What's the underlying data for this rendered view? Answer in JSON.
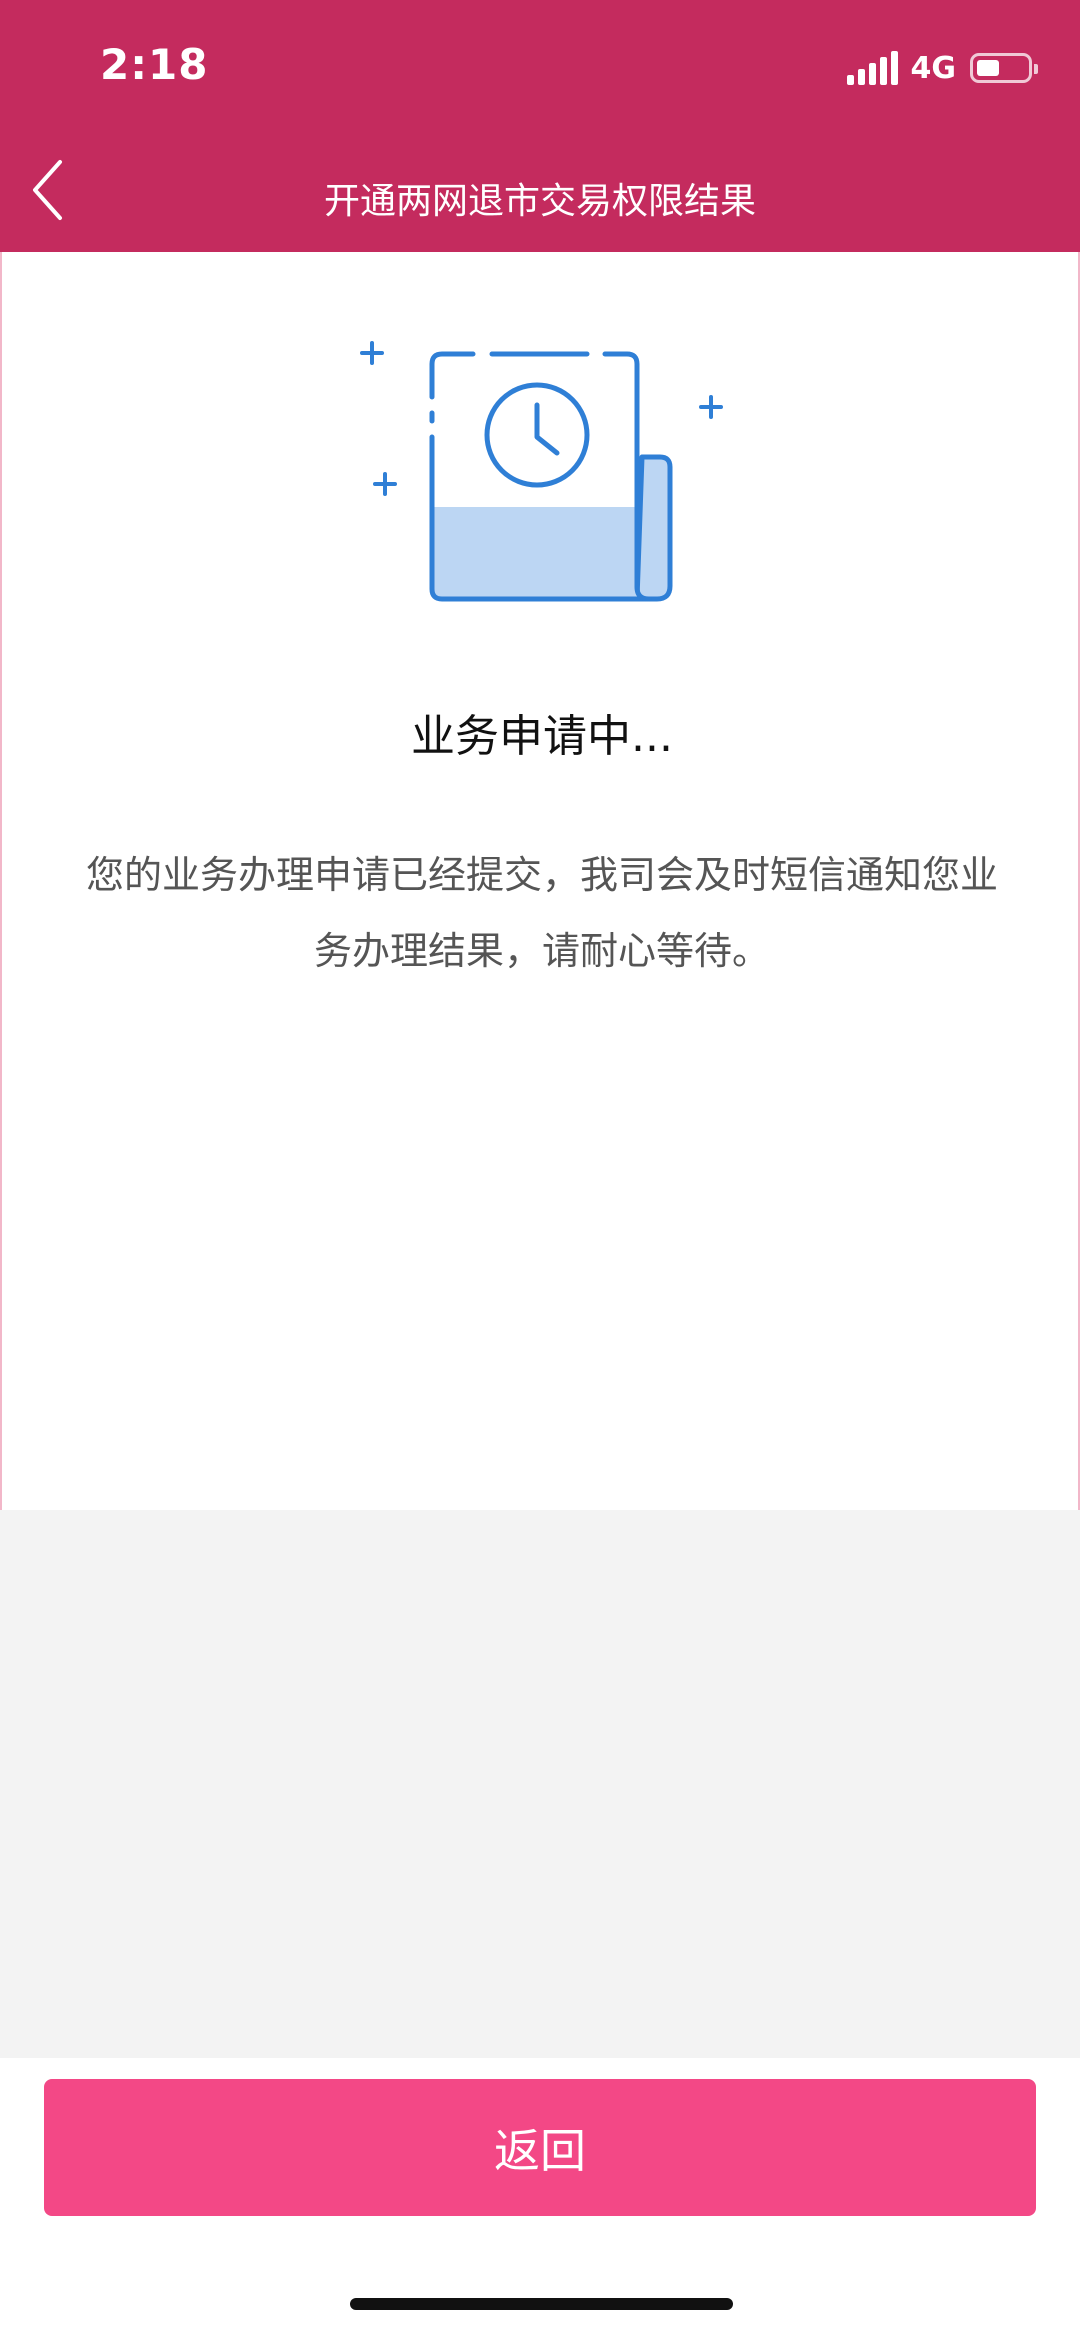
{
  "status_bar": {
    "time": "2:18",
    "network": "4G"
  },
  "nav": {
    "title": "开通两网退市交易权限结果"
  },
  "content": {
    "heading": "业务申请中...",
    "description": "您的业务办理申请已经提交，我司会及时短信通知您业务办理结果，请耐心等待。"
  },
  "footer": {
    "return_label": "返回"
  },
  "colors": {
    "header": "#c42b5e",
    "button": "#f34886",
    "icon": "#2f7fd6",
    "icon_fill": "#bcd6f3"
  }
}
